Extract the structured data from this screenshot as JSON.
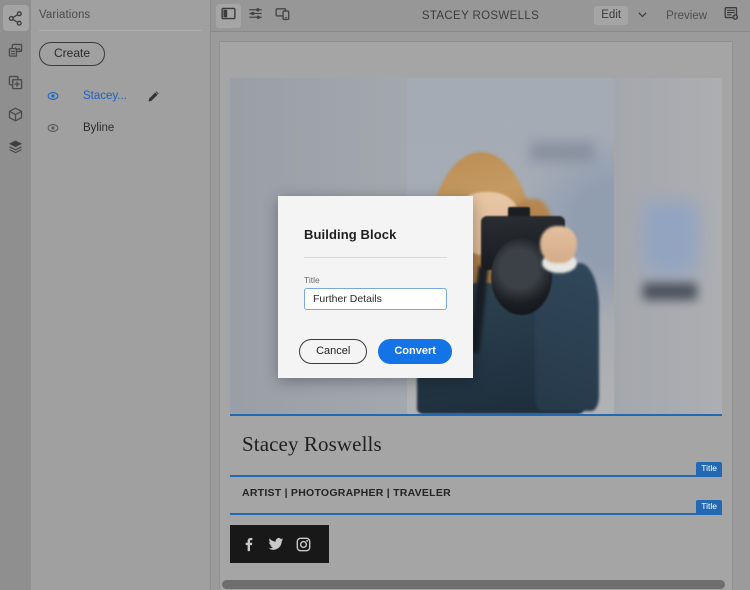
{
  "rail": {
    "items": [
      {
        "name": "content-tree-icon",
        "label": "Content Tree",
        "active": true
      },
      {
        "name": "assets-icon",
        "label": "Assets",
        "active": false
      },
      {
        "name": "components-icon",
        "label": "Components",
        "active": false
      },
      {
        "name": "package-icon",
        "label": "Content Fragments",
        "active": false
      },
      {
        "name": "layers-icon",
        "label": "Layers",
        "active": false
      }
    ]
  },
  "panel": {
    "title": "Variations",
    "create_label": "Create",
    "items": [
      {
        "label": "Stacey...",
        "selected": true,
        "has_edit": true
      },
      {
        "label": "Byline",
        "selected": false,
        "has_edit": false
      }
    ]
  },
  "topbar": {
    "title": "STACEY ROSWELLS",
    "edit_label": "Edit",
    "preview_label": "Preview",
    "left_icons": [
      {
        "name": "side-panel-toggle-icon",
        "active": true
      },
      {
        "name": "page-settings-icon",
        "active": false
      },
      {
        "name": "emulator-device-icon",
        "active": false
      }
    ],
    "right_icons": [
      {
        "name": "page-information-icon"
      }
    ],
    "mode_caret_icon": "chevron-down-icon"
  },
  "page": {
    "hero_alt": "Woman holding a DSLR camera in front of her face",
    "headline": "Stacey Roswells",
    "byline": "ARTIST | PHOTOGRAPHER | TRAVELER",
    "badge_label": "Title",
    "social": [
      {
        "name": "facebook-icon",
        "label": "Facebook"
      },
      {
        "name": "twitter-icon",
        "label": "Twitter"
      },
      {
        "name": "instagram-icon",
        "label": "Instagram"
      }
    ]
  },
  "modal": {
    "title": "Building Block",
    "field_label": "Title",
    "field_value": "Further Details",
    "field_placeholder": "",
    "cancel_label": "Cancel",
    "convert_label": "Convert"
  },
  "colors": {
    "accent_blue": "#1473e6",
    "component_outline": "#2268b3",
    "link_blue": "#1d62c4",
    "chrome_gray": "#9b9b9b",
    "panel_gray": "#a0a0a0",
    "modal_bg": "#f4f4f4",
    "social_bar": "#181818"
  }
}
